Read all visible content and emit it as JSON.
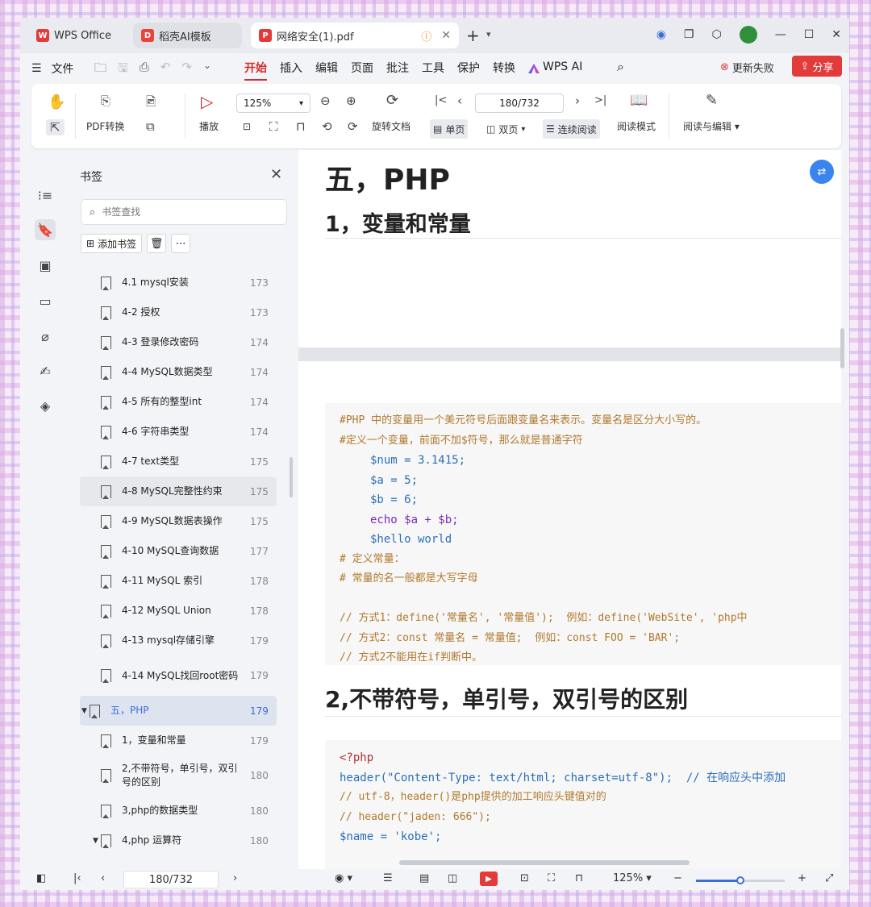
{
  "tabs": {
    "t1": "WPS Office",
    "t2": "稻壳AI模板",
    "t3": "网络安全(1).pdf"
  },
  "menu": {
    "file": "文件",
    "tabs": [
      "开始",
      "插入",
      "编辑",
      "页面",
      "批注",
      "工具",
      "保护",
      "转换"
    ],
    "wps_ai": "WPS AI",
    "update_fail": "更新失败",
    "share": "分享"
  },
  "toolbar": {
    "pdf_convert": "PDF转换",
    "play": "播放",
    "zoom": "125%",
    "page": "180/732",
    "rotate": "旋转文档",
    "single": "单页",
    "double": "双页",
    "continuous": "连续阅读",
    "read_mode": "阅读模式",
    "read_edit": "阅读与编辑"
  },
  "bookmarks": {
    "title": "书签",
    "search_placeholder": "书签查找",
    "add_label": "添加书签",
    "items": [
      {
        "label": "4.1 mysql安装",
        "page": "173"
      },
      {
        "label": "4-2 授权",
        "page": "173"
      },
      {
        "label": "4-3 登录修改密码",
        "page": "174"
      },
      {
        "label": "4-4 MySQL数据类型",
        "page": "174"
      },
      {
        "label": "4-5 所有的整型int",
        "page": "174"
      },
      {
        "label": "4-6 字符串类型",
        "page": "174"
      },
      {
        "label": "4-7 text类型",
        "page": "175"
      },
      {
        "label": "4-8 MySQL完整性约束",
        "page": "175"
      },
      {
        "label": "4-9 MySQL数据表操作",
        "page": "175"
      },
      {
        "label": "4-10 MySQL查询数据",
        "page": "177"
      },
      {
        "label": "4-11 MySQL 索引",
        "page": "178"
      },
      {
        "label": "4-12 MySQL Union",
        "page": "178"
      },
      {
        "label": "4-13 mysql存储引擎",
        "page": "179"
      },
      {
        "label": "4-14 MySQL找回root密码",
        "page": "179"
      },
      {
        "label": "五，PHP",
        "page": "179"
      },
      {
        "label": "1，变量和常量",
        "page": "179"
      },
      {
        "label": "2,不带符号，单引号，双引号的区别",
        "page": "180"
      },
      {
        "label": "3,php的数据类型",
        "page": "180"
      },
      {
        "label": "4,php 运算符",
        "page": "180"
      }
    ]
  },
  "doc": {
    "h1": "五，PHP",
    "h2a": "1，变量和常量",
    "h2b": "2,不带符号，单引号，双引号的区别",
    "code1": {
      "l1": "#PHP 中的变量用一个美元符号后面跟变量名来表示。变量名是区分大小写的。",
      "l2": "#定义一个变量，前面不加$符号，那么就是普通字符",
      "l3": "$num = 3.1415;",
      "l4": "$a = 5;",
      "l5": "$b = 6;",
      "l6": "echo $a + $b;",
      "l7": "$hello world",
      "l8": "# 定义常量：",
      "l9": "# 常量的名一般都是大写字母",
      "l10": "// 方式1：define('常量名', '常量值');  例如：define('WebSite', 'php中",
      "l11": "// 方式2：const 常量名 = 常量值;  例如：const FOO = 'BAR';",
      "l12": "// 方式2不能用在if判断中。"
    },
    "code2": {
      "l1": "<?php",
      "l2": "header(\"Content-Type: text/html; charset=utf-8\");  // 在响应头中添加",
      "l3": "// utf-8，header()是php提供的加工响应头键值对的",
      "l4": "// header(\"jaden: 666\");",
      "l5": "$name = 'kobe';"
    }
  },
  "status": {
    "page": "180/732",
    "zoom": "125%"
  }
}
